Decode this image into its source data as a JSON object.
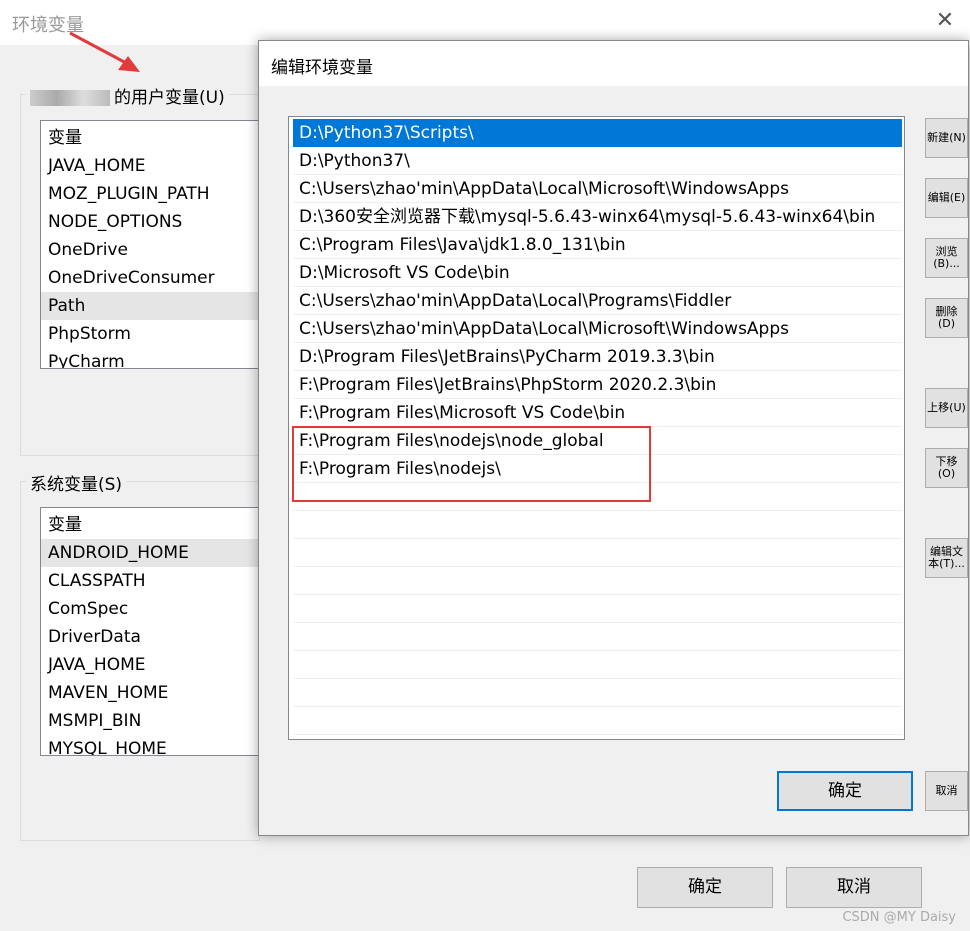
{
  "main_window": {
    "title": "环境变量",
    "close": "✕",
    "user_group_label": "的用户变量(U)",
    "user_vars": [
      "变量",
      "JAVA_HOME",
      "MOZ_PLUGIN_PATH",
      "NODE_OPTIONS",
      "OneDrive",
      "OneDriveConsumer",
      "Path",
      "PhpStorm",
      "PyCharm"
    ],
    "system_group_label": "系统变量(S)",
    "system_vars": [
      "变量",
      "ANDROID_HOME",
      "CLASSPATH",
      "ComSpec",
      "DriverData",
      "JAVA_HOME",
      "MAVEN_HOME",
      "MSMPI_BIN",
      "MYSQL_HOME"
    ],
    "ok": "确定",
    "cancel": "取消"
  },
  "edit_dialog": {
    "title": "编辑环境变量",
    "paths": [
      "D:\\Python37\\Scripts\\",
      "D:\\Python37\\",
      "C:\\Users\\zhao'min\\AppData\\Local\\Microsoft\\WindowsApps",
      "D:\\360安全浏览器下载\\mysql-5.6.43-winx64\\mysql-5.6.43-winx64\\bin",
      "C:\\Program Files\\Java\\jdk1.8.0_131\\bin",
      "D:\\Microsoft VS Code\\bin",
      "C:\\Users\\zhao'min\\AppData\\Local\\Programs\\Fiddler",
      "C:\\Users\\zhao'min\\AppData\\Local\\Microsoft\\WindowsApps",
      "D:\\Program Files\\JetBrains\\PyCharm 2019.3.3\\bin",
      "F:\\Program Files\\JetBrains\\PhpStorm 2020.2.3\\bin",
      "F:\\Program Files\\Microsoft VS Code\\bin",
      "F:\\Program Files\\nodejs\\node_global",
      "F:\\Program Files\\nodejs\\"
    ],
    "selected_index": 0,
    "side_buttons": [
      "新建(N)",
      "编辑(E)",
      "浏览(B)...",
      "删除(D)",
      "上移(U)",
      "下移(O)",
      "编辑文本(T)..."
    ],
    "ok": "确定",
    "cancel": "取消"
  },
  "annotation_color": "#e23b3b",
  "accent": "#0078d7",
  "watermark": "CSDN @MY Daisy"
}
